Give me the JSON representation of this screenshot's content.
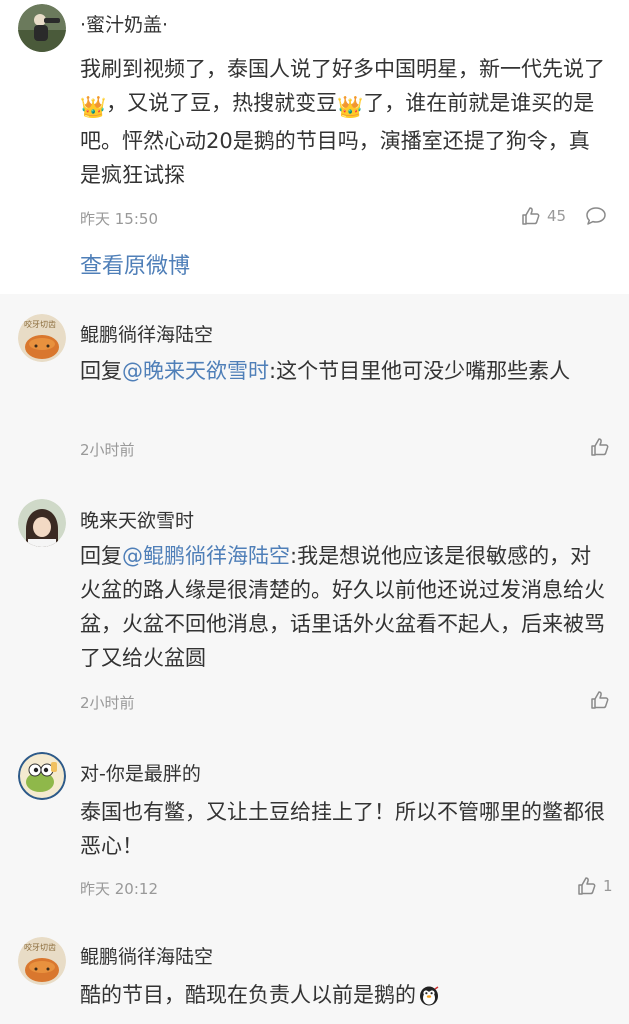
{
  "main_comment": {
    "username": "·蜜汁奶盖·",
    "text_part1": "我刷到视频了，泰国人说了好多中国明星，新一代先说了",
    "crown_emoji": "👑",
    "text_part2": "，又说了豆，热搜就变豆",
    "text_part3": "了，谁在前就是谁买的是吧。怦然心动20是鹅的节目吗，演播室还提了狗令，真是疯狂试探",
    "time": "昨天 15:50",
    "like_count": "45",
    "view_original_label": "查看原微博"
  },
  "replies": [
    {
      "username": "鲲鹏徜徉海陆空",
      "avatar_text": "咬牙切齿",
      "reply_prefix": "回复",
      "mention": "@晚来天欲雪时",
      "text": ":这个节目里他可没少嘴那些素人",
      "time": "2小时前",
      "like_count": ""
    },
    {
      "username": "晚来天欲雪时",
      "reply_prefix": "回复",
      "mention": "@鲲鹏徜徉海陆空",
      "text": ":我是想说他应该是很敏感的，对火盆的路人缘是很清楚的。好久以前他还说过发消息给火盆，火盆不回他消息，话里话外火盆看不起人，后来被骂了又给火盆圆",
      "time": "2小时前",
      "like_count": ""
    },
    {
      "username": "对-你是最胖的",
      "text": "泰国也有鳖，又让土豆给挂上了！所以不管哪里的鳖都很恶心！",
      "time": "昨天 20:12",
      "like_count": "1"
    },
    {
      "username": "鲲鹏徜徉海陆空",
      "avatar_text": "咬牙切齿",
      "text": "酷的节目，酷现在负责人以前是鹅的"
    }
  ]
}
